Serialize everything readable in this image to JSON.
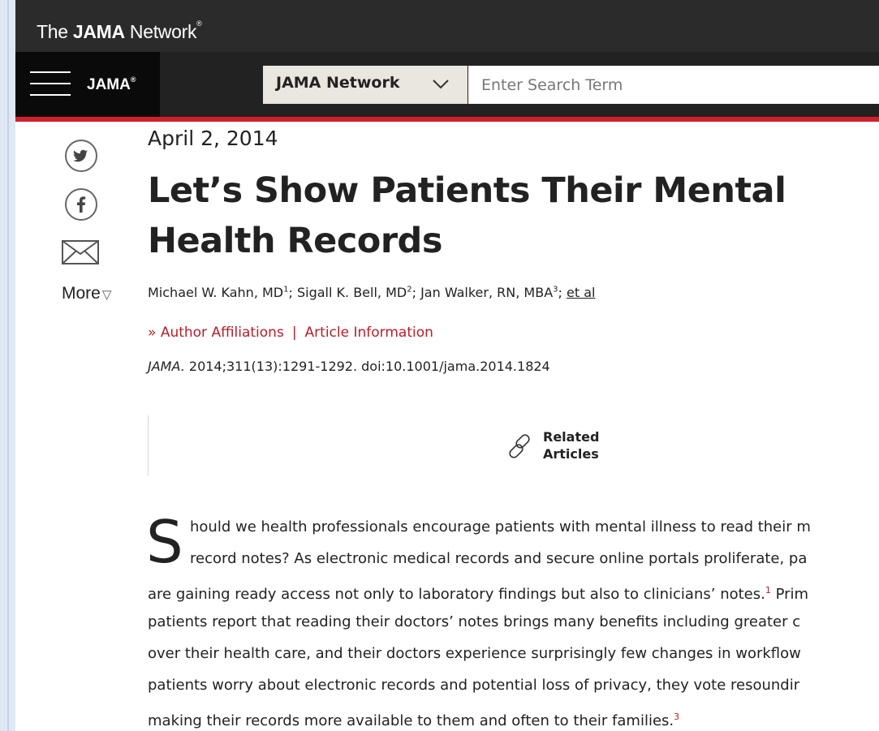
{
  "topbar": {
    "brand_prefix": "The ",
    "brand_bold": "JAMA",
    "brand_suffix": " Network",
    "brand_mark": "®"
  },
  "nav": {
    "journal": "JAMA",
    "journal_mark": "®",
    "menu_icon": "hamburger-icon",
    "search_scope": "JAMA Network",
    "search_placeholder": "Enter Search Term"
  },
  "share": {
    "icons": [
      "twitter-icon",
      "facebook-icon",
      "mail-icon"
    ],
    "twitter_glyph": "t",
    "facebook_glyph": "f",
    "more_label": "More",
    "more_glyph": "▽"
  },
  "article": {
    "date": "April 2, 2014",
    "title": "Let’s Show Patients Their Mental Health Records",
    "authors": [
      {
        "name": "Michael W. Kahn, MD",
        "sup": "1"
      },
      {
        "name": "Sigall K. Bell, MD",
        "sup": "2"
      },
      {
        "name": "Jan Walker, RN, MBA",
        "sup": "3"
      }
    ],
    "et_al": "et al",
    "affiliations_prefix": "»",
    "affiliations_link": "Author Affiliations",
    "separator": "|",
    "article_info_link": "Article Information",
    "citation_journal": "JAMA.",
    "citation_rest": " 2014;311(13):1291-1292. doi:10.1001/jama.2014.1824",
    "related_line1": "Related",
    "related_line2": "Articles",
    "drop_cap": "S",
    "body_lines": [
      {
        "text": "hould we health professionals encourage patients with mental illness to read their m",
        "sup": ""
      },
      {
        "text": "record notes? As electronic medical records and secure online portals proliferate, pa",
        "sup": ""
      },
      {
        "text": "are gaining ready access not only to laboratory findings but also to clinicians’ notes.",
        "sup": "1",
        "after": " Prim"
      },
      {
        "text": "patients report that reading their doctors’ notes brings many benefits including greater c",
        "sup": ""
      },
      {
        "text": "over their health care, and their doctors experience surprisingly few changes in workflow",
        "sup": ""
      },
      {
        "text": "patients worry about electronic records and potential loss of privacy, they vote resoundir",
        "sup": ""
      },
      {
        "text": "making their records more available to them and often to their families.",
        "sup": "3"
      }
    ]
  },
  "colors": {
    "accent_red": "#cf1f2e",
    "link_red": "#b3202b",
    "topbar": "#2b2b2b",
    "navbar": "#222222",
    "select_bg": "#e9e7de"
  }
}
